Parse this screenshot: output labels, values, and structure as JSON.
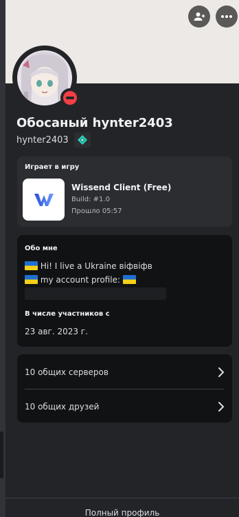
{
  "profile": {
    "display_name": "Обосаный hynter2403",
    "username": "hynter2403",
    "status": "do-not-disturb",
    "badge_icon": "nitro-gem-icon"
  },
  "activity": {
    "section_title": "Играет в игру",
    "game_name": "Wissend Client (Free)",
    "build": "Build: #1.0",
    "elapsed": "Прошло 05:57"
  },
  "about": {
    "section_title": "Обо мне",
    "line1": "Hi! I live a Ukraine віфвіфв",
    "line2": "my account profile:",
    "member_since_title": "В числе участников с",
    "member_since_date": "23 авг. 2023 г."
  },
  "mutual": {
    "servers": "10 общих серверов",
    "friends": "10 общих друзей"
  },
  "footer": {
    "full_profile": "Полный профиль"
  },
  "colors": {
    "panel_bg": "#232428",
    "card_bg": "#111214",
    "dnd_red": "#f23f43",
    "banner": "#ece9e6",
    "flag_blue": "#1f6fd1",
    "flag_yellow": "#f5d018",
    "badge_teal": "#2dd4bf"
  }
}
